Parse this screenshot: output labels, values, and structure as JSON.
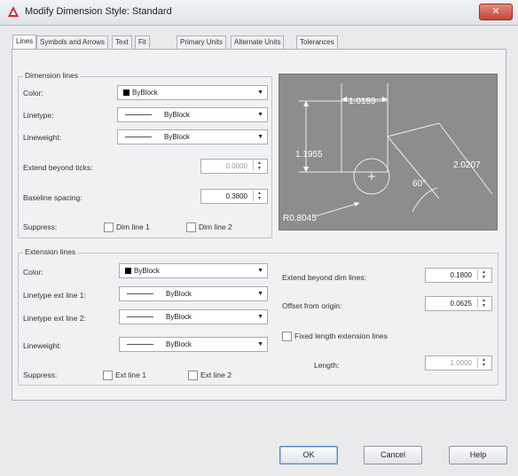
{
  "window": {
    "title": "Modify Dimension Style: Standard",
    "close_label": "✕"
  },
  "tabs": [
    "Lines",
    "Symbols and Arrows",
    "Text",
    "Fit",
    "Primary Units",
    "Alternate Units",
    "Tolerances"
  ],
  "dimension_lines": {
    "legend": "Dimension lines",
    "color_label": "Color:",
    "color_value": "ByBlock",
    "linetype_label": "Linetype:",
    "linetype_value": "ByBlock",
    "lineweight_label": "Lineweight:",
    "lineweight_value": "ByBlock",
    "extend_label": "Extend beyond ticks:",
    "extend_value": "0.0000",
    "baseline_label": "Baseline spacing:",
    "baseline_value": "0.3800",
    "suppress_label": "Suppress:",
    "dim_line_1": "Dim line 1",
    "dim_line_2": "Dim line 2"
  },
  "extension_lines": {
    "legend": "Extension lines",
    "color_label": "Color:",
    "color_value": "ByBlock",
    "linetype1_label": "Linetype ext line 1:",
    "linetype1_value": "ByBlock",
    "linetype2_label": "Linetype ext line 2:",
    "linetype2_value": "ByBlock",
    "lineweight_label": "Lineweight:",
    "lineweight_value": "ByBlock",
    "suppress_label": "Suppress:",
    "ext_line_1": "Ext line 1",
    "ext_line_2": "Ext line 2",
    "extend_label": "Extend beyond dim lines:",
    "extend_value": "0.1800",
    "offset_label": "Offset from origin:",
    "offset_value": "0.0625",
    "fixed_label": "Fixed length extension lines",
    "length_label": "Length:",
    "length_value": "1.0000"
  },
  "preview": {
    "dim_top": "1.0159",
    "dim_left": "1.1955",
    "dim_right": "2.0207",
    "angle": "60°",
    "radius": "R0.8045"
  },
  "buttons": {
    "ok": "OK",
    "cancel": "Cancel",
    "help": "Help"
  },
  "colors": {
    "accent": "#3d6fb6",
    "preview_bg": "#8d8d8d",
    "title_icon": "#cc2a1e"
  }
}
